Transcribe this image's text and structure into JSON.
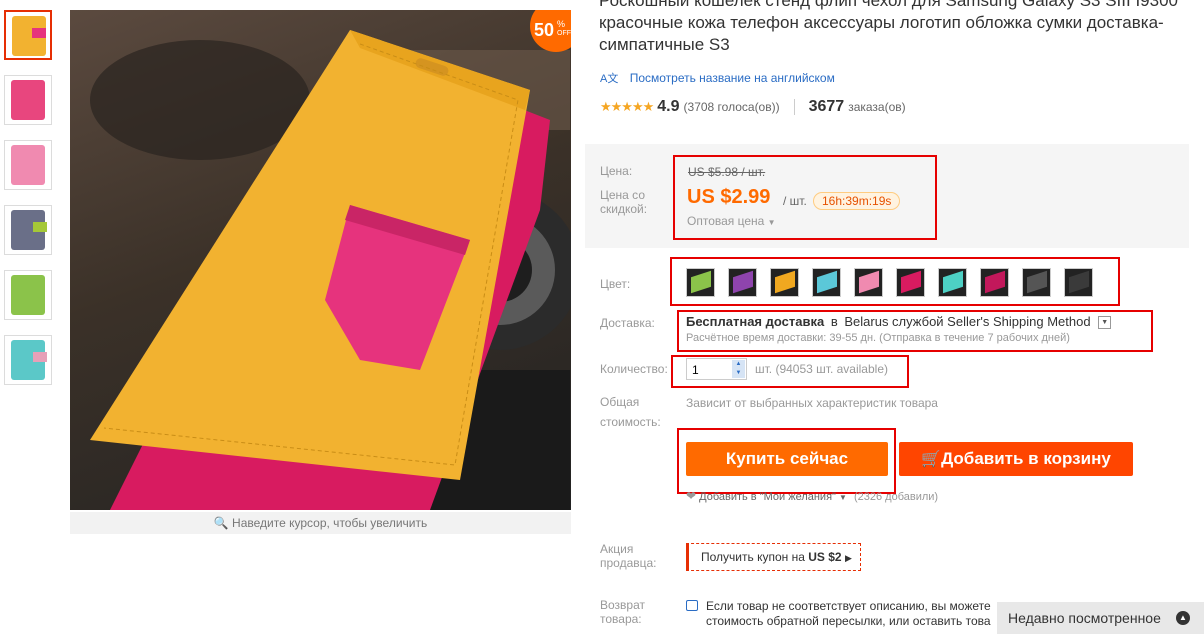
{
  "product": {
    "title": "Роскошный кошелек стенд флип чехол для Samsung Galaxy S3 SIII I9300 красочные кожа телефон аксессуары логотип обложка сумки доставка-симпатичные S3",
    "translate_link": "Посмотреть название на английском",
    "rating_value": "4.9",
    "votes": "(3708 голоса(ов))",
    "orders_count": "3677",
    "orders_label": "заказа(ов)",
    "discount_badge_number": "50",
    "discount_badge_pct": "%",
    "discount_badge_off": "OFF",
    "zoom_hint": "Наведите курсор, чтобы увеличить"
  },
  "price": {
    "label_price": "Цена:",
    "label_discount": "Цена со скидкой:",
    "old_price": "US $5.98 / шт.",
    "new_price": "US $2.99",
    "unit": "/ шт.",
    "countdown": "16h:39m:19s",
    "wholesale": "Оптовая цена"
  },
  "color": {
    "label": "Цвет:",
    "swatches": [
      "#8bc34a",
      "#8e44ad",
      "#f0a820",
      "#5bc8d8",
      "#f08ab0",
      "#d81b60",
      "#4dd0c4",
      "#c2185b",
      "#555555",
      "#3a3a3a"
    ]
  },
  "shipping": {
    "label": "Доставка:",
    "free": "Бесплатная доставка",
    "to": "в",
    "country": "Belarus службой Seller's Shipping Method",
    "estimate": "Расчётное время доставки: 39-55 дн. (Отправка в течение 7 рабочих дней)"
  },
  "quantity": {
    "label": "Количество:",
    "value": "1",
    "available": "шт. (94053 шт. available)"
  },
  "total": {
    "label_1": "Общая",
    "label_2": "стоимость:",
    "text": "Зависит от выбранных характеристик товара"
  },
  "buttons": {
    "buy_now": "Купить сейчас",
    "add_to_cart": "Добавить в корзину"
  },
  "wishlist": {
    "label": "Добавить в \"Мои желания\"",
    "count": "(2326 добавили)"
  },
  "promo": {
    "label_1": "Акция",
    "label_2": "продавца:",
    "coupon_text": "Получить купон на",
    "coupon_amount": "US $2"
  },
  "returns": {
    "label_1": "Возврат",
    "label_2": "товара:",
    "line_1": "Если товар не соответствует описанию, вы можете",
    "line_2": "стоимость обратной пересылки, или оставить това"
  },
  "recently_viewed": {
    "label": "Недавно посмотренное"
  },
  "colors": {
    "accent": "#ff6a00",
    "price_red": "#e65100",
    "annotation": "#e60000"
  }
}
